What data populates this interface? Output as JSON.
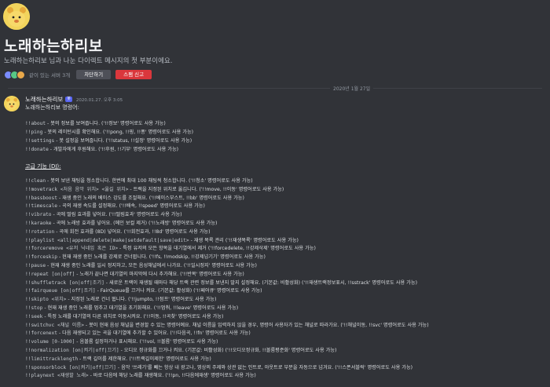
{
  "header": {
    "title": "노래하는하리보",
    "subtitle": "노래하는하리보 님과 나눈 다이렉트 메시지의 첫 부분이에요.",
    "mutual_servers": "같이 있는 서버 3개",
    "remove_friend_label": "차단하기",
    "report_label": "스팸 신고"
  },
  "date_divider": "2020년 1월 27일",
  "message": {
    "author": "노래하는하리보",
    "tag": "봇",
    "timestamp": "2020.01.27. 오후 3:05",
    "intro": "노래하는하리보 명령어:"
  },
  "basic_commands": [
    {
      "name": "!!about",
      "desc": "- 봇의 정보를 보여줍니다. ('!!정보' 명령어로도 사용 가능)"
    },
    {
      "name": "!!ping",
      "desc": "- 봇의 레이턴시를 확인해요. ('!!pong, !!핑, !!퐁' 명령어로도 사용 가능)"
    },
    {
      "name": "!!settings",
      "desc": "- 봇 설정을 보여줍니다. ('!!status, !!설정' 명령어로도 사용 가능)"
    },
    {
      "name": "!!donate",
      "desc": "- 개발자에게 후원해요. ('!!후원, !!기부' 명령어로도 사용 가능)"
    }
  ],
  "advanced_title": "고급 기능 (DJ):",
  "advanced_commands": [
    {
      "name": "!!clean",
      "desc": "- 봇의 보낸 채팅을 청소합니다. 한번에 최대 100 채팅씩 청소합니다. ('!!청소' 명령어로도 사용 가능)"
    },
    {
      "name": "!!movetrack <처음 음악 위치> <옮길 위치>",
      "desc": "- 트랙을 지정된 위치로 옮깁니다. ('!!move, !!이동' 명령어로도 사용 가능)"
    },
    {
      "name": "!!bassboost",
      "desc": "- 재생 중인 노래의 베이스 강도를 조절해요. ('!!베이스부스트, !!bb' 명령어로도 사용 가능)"
    },
    {
      "name": "!!timescale",
      "desc": "- 곡의 재생 속도를 설정해요. ('!!배속, !!speed' 명령어로도 사용 가능)"
    },
    {
      "name": "!!vibrato",
      "desc": "- 곡에 떨림 효과를 넣어요. ('!!떨림효과' 명령어로도 사용 가능)"
    },
    {
      "name": "!!karaoke",
      "desc": "- 곡에 노래방 효과를 넣어요. (메인 보컬 제거) ('!!노래방' 명령어로도 사용 가능)"
    },
    {
      "name": "!!rotation",
      "desc": "- 곡에 회전 효과를 (8D) 넣어요. ('!!회전효과, !!8d' 명령어로도 사용 가능)"
    },
    {
      "name": "!!playlist <all|append|delete|make|setdefault|save|edit>",
      "desc": "- 재생 목록 관리 ('!!재생목록' 명령어로도 사용 가능)"
    },
    {
      "name": "!!forceremove <유저 닉네임 혹은 ID>",
      "desc": "- 특정 유저의 모든 항목을 대기열에서 제거 ('!!forcedelete, !!강제삭제' 명령어로도 사용 가능)"
    },
    {
      "name": "!!forceskip",
      "desc": "- 현재 재생 중인 노래를 강제로 건너뜁니다. ('!!fs, !!modskip, !!강제넘기기' 명령어로도 사용 가능)"
    },
    {
      "name": "!!pause",
      "desc": "- 현재 재생 중인 노래를 일시 정지하고, 모든 음성채널에서 나가요. ('!!일시정지' 명령어로도 사용 가능)"
    },
    {
      "name": "!!repeat [on|off]",
      "desc": "- 노래가 끝나면 대기열의 마지막에 다시 추가해요. ('!!반복' 명령어로도 사용 가능)"
    },
    {
      "name": "!!shuffletrack [on|off|조기]",
      "desc": "- 새로운 트랙이 재생될 때마다 해당 트랙 관련 정보를 보낸지 말지 설정해요. (기본값: 비활성화) ('!!재생트랙정보표시, !!sstrack' 명령어로도 사용 가능)"
    },
    {
      "name": "!!fairqueue [on|off|조기]",
      "desc": "- FairQueue를 끄거나 켜요. (기본값: 활성화) ('!!페어큐' 명령어로도 사용 가능)"
    },
    {
      "name": "!!skipto <위치>",
      "desc": "- 지정된 노래로 건너 뜁니다. ('!!jumpto, !!점프' 명령어로도 사용 가능)"
    },
    {
      "name": "!!stop",
      "desc": "- 현재 재생 중인 노래를 멈추고 대기열을 초기화해요. ('!!멈춰, !!leave' 명령어로도 사용 가능)"
    },
    {
      "name": "!!seek",
      "desc": "- 특정 노래를 대기열의 다른 위치로 이동시켜요. ('!!이동, !!곡찾' 명령어로도 사용 가능)"
    },
    {
      "name": "!!switchvc <채널 이름>",
      "desc": "- 봇이 현재 음성 채널을 변경할 수 있는 명령어예요. 채널 이름을 입력하지 않을 경우, 명령어 사용자가 있는 채널로 따라가요. ('!!채널이동, !!svc' 명령어로도 사용 가능)"
    },
    {
      "name": "!!forcenext",
      "desc": "- 다음 재생되고 있는 곡을 대기열에 추가할 수 있어요. ('!!다음곡, !!fn' 명령어로도 사용 가능)"
    },
    {
      "name": "!!volume [0-1000]",
      "desc": "- 음볼륨 설정하거나 표시해요. ('!!vol, !!볼륨' 명령어로도 사용 가능)"
    },
    {
      "name": "!!normalization [on|켜기|off|끄기]",
      "desc": "- 오디오 정규화를 끄거나 켜요. (기본값: 비활성화) ('!!오디오정규화, !!볼륨평준화' 명령어로도 사용 가능)"
    },
    {
      "name": "!!limittracklength",
      "desc": "- 트랙 길이를 제한해요. ('!!트랙길이제한' 명령어로도 사용 가능)"
    },
    {
      "name": "!!sponsorblock [on|켜기|off|끄기]",
      "desc": "- 음악 '쓰레기'를 빼는 항상 내 광고나, 영상의 주제와 상관 없는 인트로, 아웃트로 부분을 자동으로 넘겨요. ('!!스폰서블럭' 명령어로도 사용 가능)"
    },
    {
      "name": "!!playnext <재생할 노래>",
      "desc": "- 바로 다음에 해당 노래를 재생해요. ('!!pn, !!다음에재생' 명령어로도 사용 가능)"
    }
  ],
  "colors": {
    "background": "#313338",
    "accent_blurple": "#5865f2",
    "danger": "#da373c",
    "avatar_yellow": "#f2d45c"
  }
}
